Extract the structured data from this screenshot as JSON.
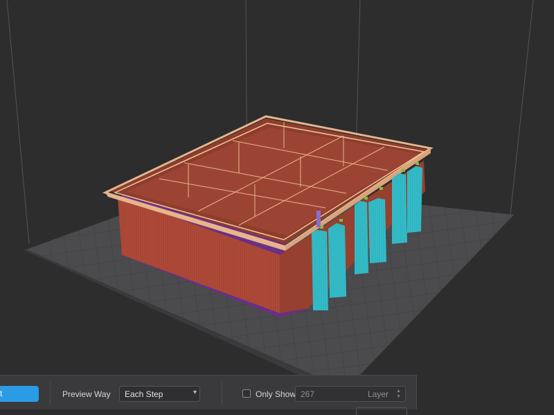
{
  "toolbar": {
    "action_button_text": "t",
    "preview_way_label": "Preview Way",
    "preview_way_value": "Each Step",
    "only_show_label": "Only Show",
    "only_show_checked": false,
    "layer_value": "267",
    "layer_suffix": "Layer"
  },
  "icons": {
    "select_caret": "▾",
    "spin_up": "▲",
    "spin_down": "▼"
  },
  "colors": {
    "background": "#2d2d2e",
    "build_plate": "#4b4b4d",
    "wall": "#a84535",
    "wall_top": "#e8b48a",
    "support": "#2fb6c2",
    "base_layer": "#6a2f86",
    "accent_button": "#2b9be6"
  }
}
